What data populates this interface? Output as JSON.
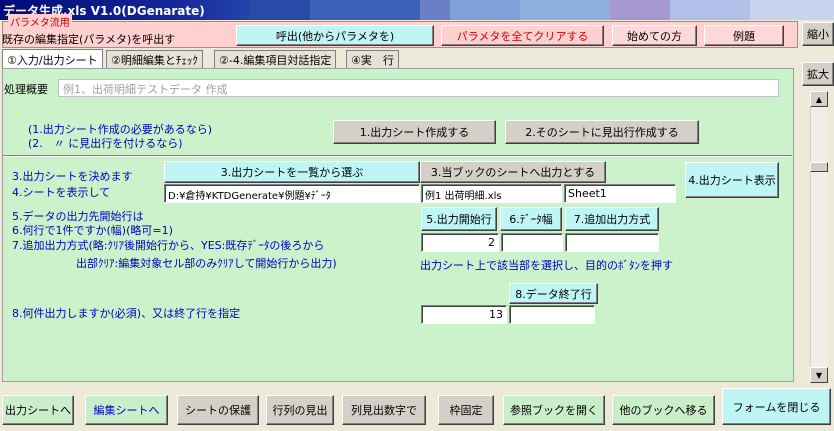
{
  "window": {
    "title": "データ生成.xls  V1.0(DGenarate)"
  },
  "param_group": {
    "legend": "パラメタ流用",
    "description": "既存の編集指定(パラメタ)を呼出す",
    "call_button": "呼出(他からパラメタを)",
    "clear_button": "パラメタを全てクリアする",
    "beginner_button": "始めての方",
    "example_button": "例題"
  },
  "side": {
    "minimize_button": "縮小",
    "expand_button": "拡大",
    "scroll_up_icon": "▲",
    "scroll_down_icon": "▼"
  },
  "tabs": [
    {
      "label": "①入力/出力シート",
      "active": true
    },
    {
      "label": "②明細編集とﾁｪｯｸ",
      "active": false
    },
    {
      "label": "②-4.編集項目対話指定",
      "active": false
    },
    {
      "label": "④実　行",
      "active": false
    }
  ],
  "processing": {
    "label": "処理概要",
    "value": "例1、出荷明細テストデータ 作成"
  },
  "section1": {
    "note1": "(1.出力シート作成の必要があるなら)",
    "note2": "(2.　〃  に見出行を付けるなら)",
    "create_sheet_button": "1.出力シート作成する",
    "create_header_button": "2.そのシートに見出行作成する"
  },
  "section2": {
    "label3": "3.出力シートを決めます",
    "label4": "4.シートを表示して",
    "select_list_button": "3.出力シートを一覧から選ぶ",
    "current_book_button": "3.当ブックのシートへ出力とする",
    "show_sheet_button": "4.出力シート表示",
    "path_value": "D:¥倉持¥KTDGenerate¥例題¥ﾃﾞｰﾀ",
    "book_value": "例1 出荷明細.xls",
    "sheet_value": "Sheet1",
    "label5": "5.データの出力先開始行は",
    "label6": "6.何行で1件ですか(幅)(略可=1)",
    "label7": "7.追加出力方式(略:ｸﾘｱ後開始行から、YES:既存ﾃﾞｰﾀの後ろから",
    "label7b": "出部ｸﾘｱ:編集対象セル部のみｸﾘｱして開始行から出力)",
    "start_row_button": "5.出力開始行",
    "data_width_button": "6.ﾃﾞｰﾀ幅",
    "append_mode_button": "7.追加出力方式",
    "start_row_value": "2",
    "data_width_value": "",
    "append_mode_value": "",
    "instruction": "出力シート上で該当部を選択し、目的のﾎﾞﾀﾝを押す",
    "label8": "8.何件出力しますか(必須)、又は終了行を指定",
    "end_row_button": "8.データ終了行",
    "count_value": "13",
    "end_row_value": ""
  },
  "bottom_buttons": [
    {
      "label": "出力シートへ",
      "style": "green"
    },
    {
      "label": "編集シートへ",
      "style": "green-blue"
    },
    {
      "label": "シートの保護",
      "style": "grey"
    },
    {
      "label": "行列の見出",
      "style": "grey"
    },
    {
      "label": "列見出数字で",
      "style": "grey"
    },
    {
      "label": "枠固定",
      "style": "grey"
    },
    {
      "label": "参照ブックを開く",
      "style": "green"
    },
    {
      "label": "他のブックへ移る",
      "style": "green"
    },
    {
      "label": "フォームを閉じる",
      "style": "cyan"
    }
  ],
  "colors": {
    "main_panel": "#ccf2cc",
    "param_panel": "#ffd0d0",
    "label_blue": "#0000c0",
    "cyan_button": "#bff5f5"
  }
}
